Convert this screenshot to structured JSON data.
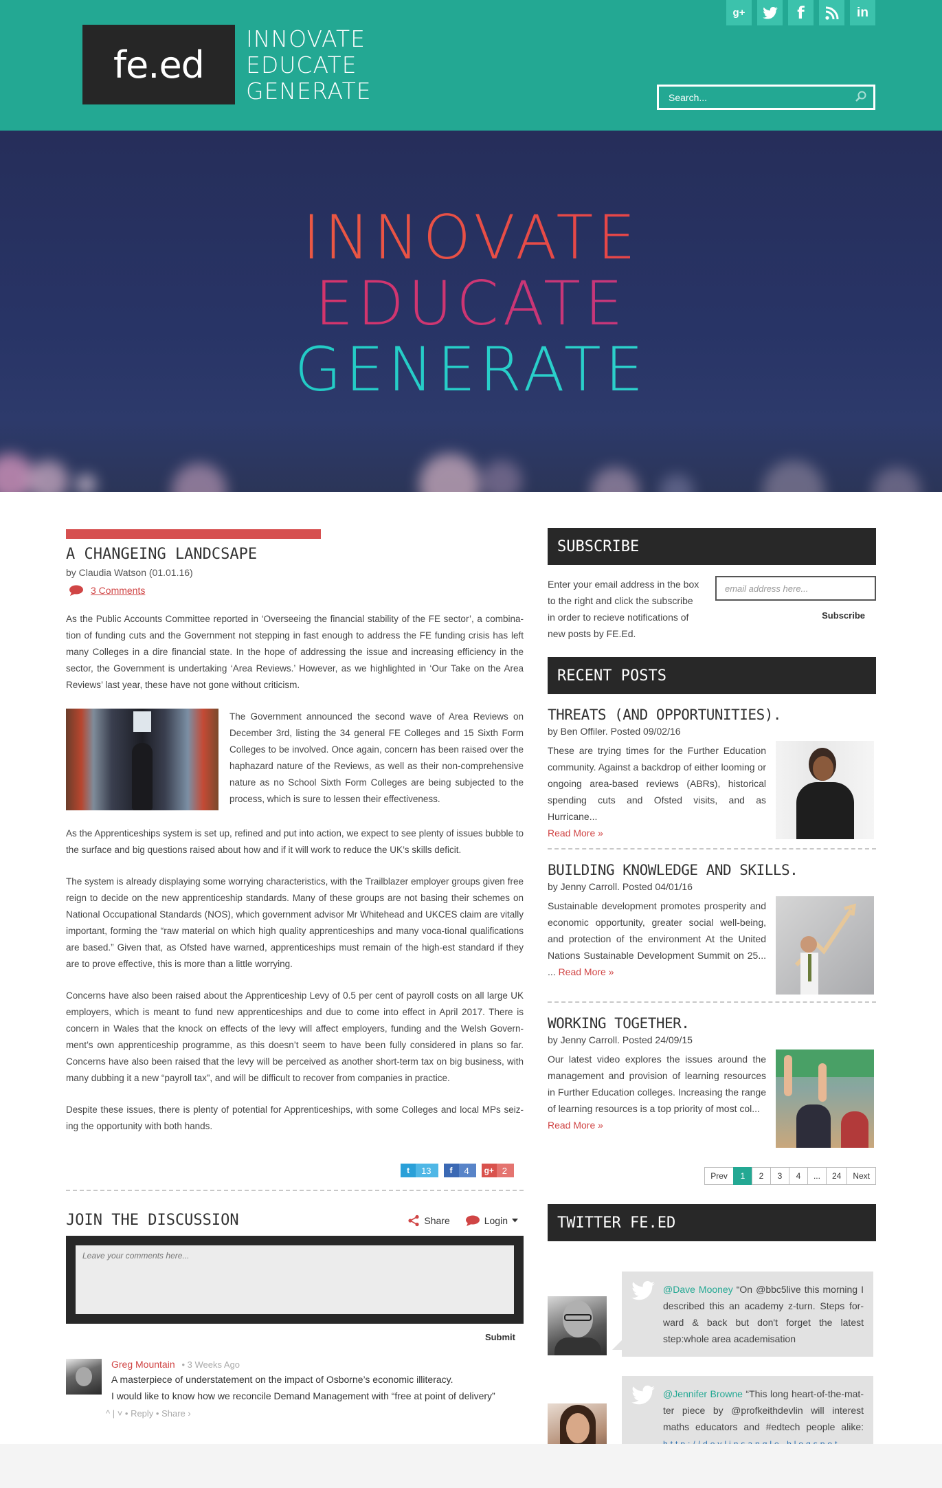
{
  "header": {
    "logo": "fe.ed",
    "tagline": [
      "INNOVATE",
      "EDUCATE",
      "GENERATE"
    ],
    "social": [
      {
        "icon": "google-plus-icon",
        "glyph": "g+"
      },
      {
        "icon": "twitter-icon",
        "glyph": "t"
      },
      {
        "icon": "facebook-icon",
        "glyph": "f"
      },
      {
        "icon": "rss-icon",
        "glyph": "rss"
      },
      {
        "icon": "linkedin-icon",
        "glyph": "in"
      }
    ],
    "search_placeholder": "Search..."
  },
  "hero": {
    "lines": [
      "INNOVATE",
      "EDUCATE",
      "GENERATE"
    ]
  },
  "article": {
    "title": "A CHANGEING LANDCSAPE",
    "byline": "by Claudia Watson (01.01.16)",
    "comments_link": "3 Comments",
    "p1": "As the Public Accounts Committee reported in ‘Overseeing the financial stability of the FE sector’, a combina-tion of funding cuts and the Government not stepping in fast enough to address the FE funding crisis has left many Colleges in a dire financial state. In the hope of addressing the issue and increasing efficiency in the sector, the Government is undertaking ‘Area Reviews.’ However, as we highlighted in ‘Our Take on the Area Reviews’ last year, these have not gone without criticism.",
    "p2": "The Government announced the second wave of Area Reviews on December 3rd, listing the 34 general FE Colleges and 15 Sixth Form Colleges to be involved. Once again, concern has been raised over the haphazard nature of the Reviews, as well as their non-comprehensive nature as no School Sixth Form Colleges are being subjected to the process, which is sure to lessen their effectiveness.",
    "p3": "As the Apprenticeships system is set up, refined and put into action, we expect to see plenty of issues bubble to the surface and big questions raised about how and if it will work to reduce the UK’s skills deficit.",
    "p4": "The system is already displaying some worrying characteristics, with the Trailblazer employer groups given free reign to decide on the new apprenticeship standards. Many of these groups are not basing their schemes on National Occupational Standards (NOS), which government advisor Mr Whitehead and UKCES claim are vitally important, forming the “raw material on which high quality apprenticeships and many voca-tional qualifications are based.” Given that, as Ofsted have warned, apprenticeships must remain of the high-est standard if they are to prove effective, this is more than a little worrying.",
    "p5": "Concerns have also been raised about the Apprenticeship Levy of 0.5 per cent of payroll costs on all large UK employers, which is meant to fund new apprenticeships and due to come into effect in April 2017. There is concern in Wales that the knock on effects of the levy will affect employers, funding and the Welsh Govern-ment’s own apprenticeship programme, as this doesn’t seem to have been fully considered in plans so far. Concerns have also been raised that the levy will be perceived as another short-term tax on big business, with many dubbing it a new “payroll tax”, and will be difficult to recover from companies in practice.",
    "p6": "Despite these issues, there is plenty of potential for Apprenticeships, with some Colleges and local MPs seiz-ing the opportunity with both hands.",
    "shares": [
      {
        "icon": "twitter-icon",
        "glyph": "t",
        "count": "13",
        "color": "#2aa0d8"
      },
      {
        "icon": "facebook-icon",
        "glyph": "f",
        "count": "4",
        "color": "#3b69b4"
      },
      {
        "icon": "google-plus-icon",
        "glyph": "g+",
        "count": "2",
        "color": "#d9524d"
      }
    ]
  },
  "discussion": {
    "title": "JOIN THE DISCUSSION",
    "share_label": "Share",
    "login_label": "Login",
    "placeholder": "Leave your comments here...",
    "submit_label": "Submit",
    "comment": {
      "name": "Greg Mountain",
      "time": "• 3 Weeks Ago",
      "line1": "A masterpiece of understatement on the impact of Osborne’s economic illiteracy.",
      "line2": "I would like to know how we reconcile Demand Management with “free at point of delivery”",
      "actions": "^ | ˅ • Reply • Share ›"
    }
  },
  "subscribe": {
    "title": "SUBSCRIBE",
    "text": "Enter your email address in the box to the right and click the subscribe in order to recieve notifications of new posts by FE.Ed.",
    "placeholder": "email address here...",
    "button": "Subscribe"
  },
  "recent": {
    "title": "RECENT POSTS",
    "posts": [
      {
        "title": "THREATS (AND OPPORTUNITIES).",
        "by": "by Ben Offiler. Posted 09/02/16",
        "body": "These are trying times for the Further Education community.  Against a backdrop of either looming or ongoing area-based reviews (ABRs), historical spending cuts and Ofsted visits, and as Hurricane...",
        "read_more": "Read More »"
      },
      {
        "title": "BUILDING KNOWLEDGE AND SKILLS.",
        "by": "by Jenny Carroll. Posted 04/01/16",
        "body": "Sustainable development promotes prosperity and economic opportunity, greater social well-being, and protection of the environment At the United Nations Sustainable Development Summit on 25... ...",
        "read_more": "Read More »"
      },
      {
        "title": "WORKING TOGETHER.",
        "by": "by Jenny Carroll. Posted 24/09/15",
        "body": "Our latest video explores the issues around the management and provision of learning resources in Further Education colleges.  Increasing the range of learning resources is a top priority of most col...",
        "read_more": "Read More »"
      }
    ],
    "pager": [
      "Prev",
      "1",
      "2",
      "3",
      "4",
      "...",
      "24",
      "Next"
    ]
  },
  "twitter": {
    "title": "TWITTER FE.ED",
    "tweets": [
      {
        "handle": "@Dave Mooney",
        "text": " “On @bbc5live this morning I described this an academy z-turn. Steps for-ward & back but don't forget the latest step:whole area academisation"
      },
      {
        "handle": "@Jennifer Browne",
        "text": " “This long heart-of-the-mat-ter piece by @profkeithdevlin will interest maths educators and #edtech people alike: ",
        "link": "http://devlinsangle.blogspot.-"
      }
    ]
  }
}
